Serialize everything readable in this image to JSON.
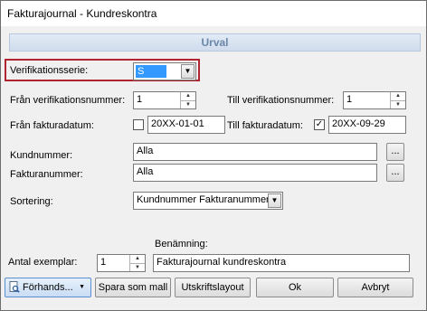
{
  "window": {
    "title": "Fakturajournal - Kundreskontra"
  },
  "section": {
    "header": "Urval"
  },
  "fields": {
    "verifikationsserie": {
      "label": "Verifikationsserie:",
      "value": "S"
    },
    "fran_verifikationsnummer": {
      "label": "Från verifikationsnummer:",
      "value": "1"
    },
    "till_verifikationsnummer": {
      "label": "Till verifikationsnummer:",
      "value": "1"
    },
    "fran_fakturadatum": {
      "label": "Från fakturadatum:",
      "value": "20XX-01-01",
      "checked": false
    },
    "till_fakturadatum": {
      "label": "Till fakturadatum:",
      "value": "20XX-09-29",
      "checked": true
    },
    "kundnummer": {
      "label": "Kundnummer:",
      "value": "Alla",
      "browse": "..."
    },
    "fakturanummer": {
      "label": "Fakturanummer:",
      "value": "Alla",
      "browse": "..."
    },
    "sortering": {
      "label": "Sortering:",
      "value": "Kundnummer Fakturanummer"
    },
    "benamning": {
      "label": "Benämning:",
      "value": "Fakturajournal kundreskontra"
    },
    "antal_exemplar": {
      "label": "Antal exemplar:",
      "value": "1"
    }
  },
  "buttons": {
    "preview": "Förhands...",
    "save_template": "Spara som mall",
    "print_layout": "Utskriftslayout",
    "ok": "Ok",
    "cancel": "Avbryt"
  },
  "colors": {
    "highlight_border": "#b0252f",
    "selection": "#3399ff",
    "header_text": "#6b86a8"
  }
}
